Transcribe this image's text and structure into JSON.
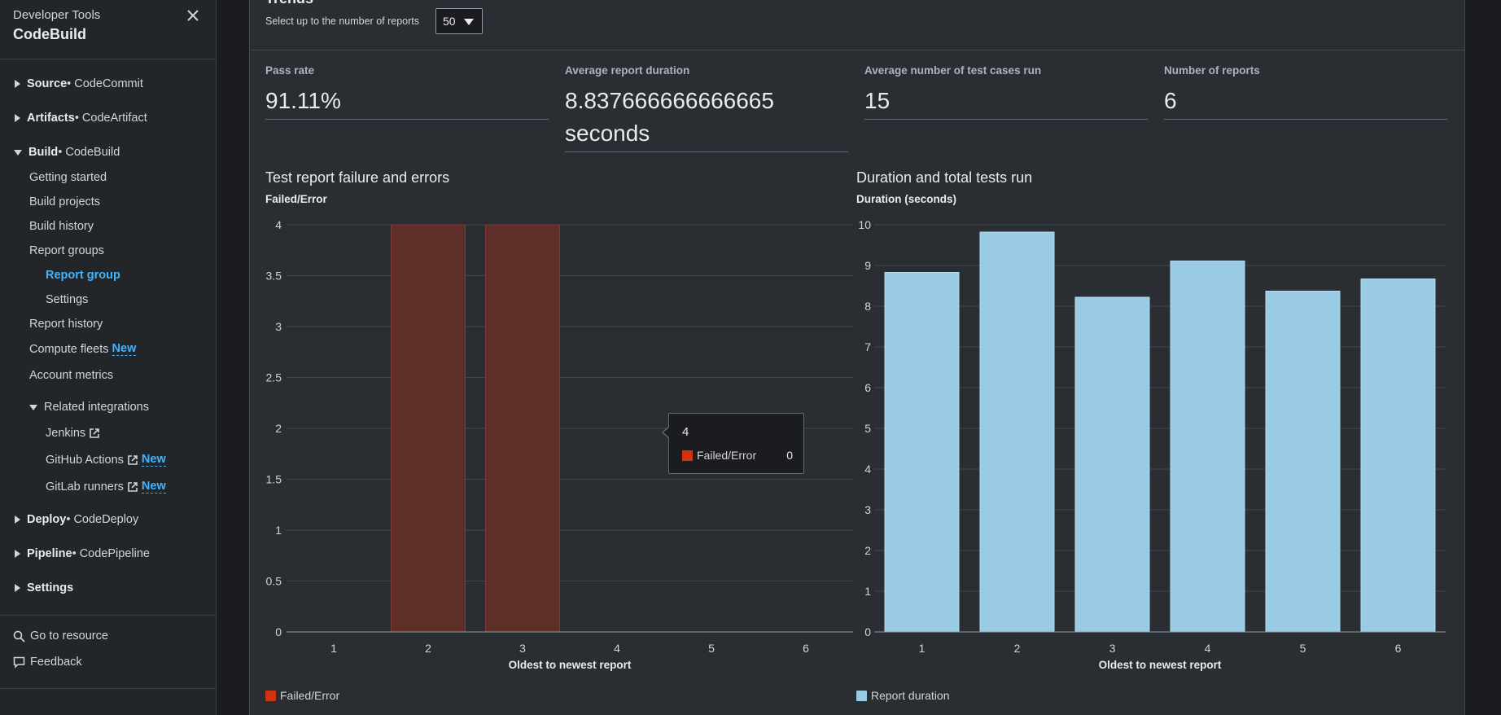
{
  "sidebar": {
    "service": "Developer Tools",
    "title": "CodeBuild",
    "sections": [
      {
        "name": "Source",
        "sub": " • CodeCommit"
      },
      {
        "name": "Artifacts",
        "sub": " • CodeArtifact"
      },
      {
        "name": "Build",
        "sub": " • CodeBuild"
      },
      {
        "name": "Deploy",
        "sub": " • CodeDeploy"
      },
      {
        "name": "Pipeline",
        "sub": " • CodePipeline"
      },
      {
        "name": "Settings",
        "sub": ""
      }
    ],
    "build_items": {
      "getting_started": "Getting started",
      "build_projects": "Build projects",
      "build_history": "Build history",
      "report_groups": "Report groups",
      "report_group": "Report group",
      "settings": "Settings",
      "report_history": "Report history",
      "compute_fleets": "Compute fleets",
      "account_metrics": "Account metrics",
      "related_integrations": "Related integrations",
      "jenkins": "Jenkins",
      "github_actions": "GitHub Actions",
      "gitlab_runners": "GitLab runners",
      "new_badge": "New"
    },
    "footer": {
      "go_to_resource": "Go to resource",
      "feedback": "Feedback"
    }
  },
  "trends": {
    "title": "Trends",
    "select_label": "Select up to the number of reports",
    "select_value": "50"
  },
  "metrics": [
    {
      "label": "Pass rate",
      "value": "91.11%"
    },
    {
      "label": "Average report duration",
      "value": "8.837666666666665 seconds"
    },
    {
      "label": "Average number of test cases run",
      "value": "15"
    },
    {
      "label": "Number of reports",
      "value": "6"
    }
  ],
  "tooltip": {
    "header": "4",
    "series": "Failed/Error",
    "value": "0"
  },
  "colors": {
    "failed": "#d13212",
    "failed_bar": "#5e2e28",
    "duration": "#99cbe4",
    "grid": "#414750"
  },
  "chart_data": [
    {
      "type": "bar",
      "title": "Test report failure and errors",
      "ylabel": "Failed/Error",
      "xlabel": "Oldest to newest report",
      "categories": [
        "1",
        "2",
        "3",
        "4",
        "5",
        "6"
      ],
      "series": [
        {
          "name": "Failed/Error",
          "values": [
            0,
            4,
            4,
            0,
            0,
            0
          ]
        }
      ],
      "ylim": [
        0,
        4
      ],
      "yticks": [
        "0",
        "0.5",
        "1",
        "1.5",
        "2",
        "2.5",
        "3",
        "3.5",
        "4"
      ],
      "grid": true,
      "legend": "bottom-left"
    },
    {
      "type": "bar",
      "title": "Duration and total tests run",
      "ylabel": "Duration (seconds)",
      "xlabel": "Oldest to newest report",
      "categories": [
        "1",
        "2",
        "3",
        "4",
        "5",
        "6"
      ],
      "series": [
        {
          "name": "Report duration",
          "values": [
            8.83,
            9.82,
            8.22,
            9.11,
            8.37,
            8.67
          ]
        }
      ],
      "ylim": [
        0,
        10
      ],
      "yticks": [
        "0",
        "1",
        "2",
        "3",
        "4",
        "5",
        "6",
        "7",
        "8",
        "9",
        "10"
      ],
      "grid": true,
      "legend": "bottom-left"
    }
  ]
}
